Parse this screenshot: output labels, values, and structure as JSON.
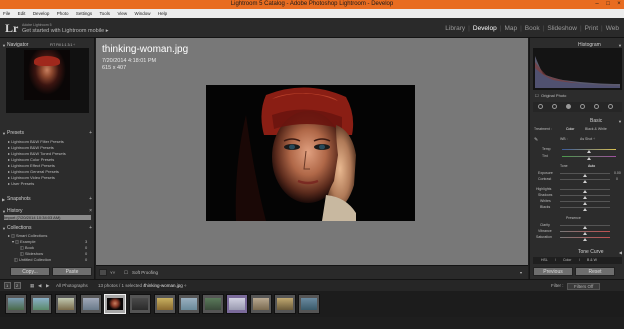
{
  "window": {
    "title": "Lightroom 5 Catalog - Adobe Photoshop Lightroom - Develop",
    "minimize": "–",
    "maximize": "□",
    "close": "×"
  },
  "menu": [
    "File",
    "Edit",
    "Develop",
    "Photo",
    "Settings",
    "Tools",
    "View",
    "Window",
    "Help"
  ],
  "identity": {
    "logo": "Lr",
    "small": "Adobe Lightroom 5",
    "big": "Get started with Lightroom mobile ▸"
  },
  "modules": [
    "Library",
    "Develop",
    "Map",
    "Book",
    "Slideshow",
    "Print",
    "Web"
  ],
  "left": {
    "navigator": {
      "title": "Navigator",
      "zoom": "FIT   Fill   1:1   3:1 ÷"
    },
    "presets": {
      "title": "Presets",
      "items": [
        "▸ Lightroom B&W Filter Presets",
        "▸ Lightroom B&W Presets",
        "▸ Lightroom B&W Toned Presets",
        "▸ Lightroom Color Presets",
        "▸ Lightroom Effect Presets",
        "▸ Lightroom General Presets",
        "▸ Lightroom Video Presets",
        "▸ User Presets"
      ]
    },
    "snapshots": {
      "title": "Snapshots"
    },
    "history": {
      "title": "History",
      "item": "Import (7/20/2014 10:34:03 AM)"
    },
    "collections": {
      "title": "Collections",
      "items": [
        {
          "label": "▸ ◫ Smart Collections",
          "count": ""
        },
        {
          "label": "▾ ◫ Example",
          "count": "3"
        },
        {
          "label": "◫ Book",
          "count": "0"
        },
        {
          "label": "◫ Slideshow",
          "count": "0"
        },
        {
          "label": "◫ Untitled Collection",
          "count": "0"
        }
      ]
    },
    "copy_btn": "Copy...",
    "paste_btn": "Paste"
  },
  "photo": {
    "filename": "thinking-woman.jpg",
    "datetime": "7/20/2014 4:18:01 PM",
    "dimensions": "615 x 407"
  },
  "toolbar": {
    "soft_proofing": "Soft Proofing"
  },
  "right": {
    "histogram": {
      "title": "Histogram",
      "original_photo": "Original Photo"
    },
    "basic": {
      "title": "Basic",
      "treatment_label": "Treatment :",
      "color": "Color",
      "bw": "Black & White",
      "wb_label": "WB :",
      "wb_value": "As Shot ÷",
      "temp": "Temp",
      "tint": "Tint",
      "tone": "Tone",
      "auto": "Auto",
      "exposure": "Exposure",
      "exposure_val": "0.00",
      "contrast": "Contrast",
      "contrast_val": "0",
      "highlights": "Highlights",
      "shadows": "Shadows",
      "whites": "Whites",
      "blacks": "Blacks",
      "presence": "Presence",
      "clarity": "Clarity",
      "vibrance": "Vibrance",
      "saturation": "Saturation"
    },
    "tone_curve": {
      "title": "Tone Curve",
      "tabs": [
        "HSL",
        "/",
        "Color",
        "/",
        "B & W"
      ]
    },
    "previous_btn": "Previous",
    "reset_btn": "Reset"
  },
  "filmstrip": {
    "page1": "1",
    "page2": "2",
    "source": "All Photographs",
    "count_text": "13 photos / 1 selected / ",
    "selected_file": "thinking-woman.jpg ÷",
    "filter_label": "Filter :",
    "filter_value": "Filters Off"
  },
  "colors": {
    "titlebar": "#e86c20",
    "panel": "#2c2c2c",
    "canvas": "#787878",
    "accent": "#ffffff"
  }
}
